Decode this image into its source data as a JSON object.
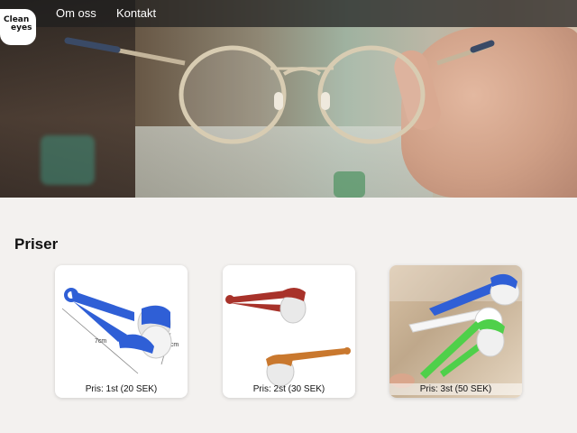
{
  "site": {
    "logo_line1": "Clean",
    "logo_line2": "eyes"
  },
  "nav": {
    "items": [
      {
        "label": "Om oss"
      },
      {
        "label": "Kontakt"
      }
    ]
  },
  "prices": {
    "title": "Priser",
    "cards": [
      {
        "caption": "Pris: 1st (20 SEK)",
        "size_w": "7cm",
        "size_h": "2cm"
      },
      {
        "caption": "Pris: 2st (30 SEK)"
      },
      {
        "caption": "Pris: 3st (50 SEK)"
      }
    ]
  },
  "colors": {
    "nav_bg": "#1e1e1e",
    "page_bg": "#f3f1ef",
    "blue": "#2f5fd6",
    "red": "#a8322a",
    "orange": "#c9782e",
    "green": "#4fd04a"
  }
}
